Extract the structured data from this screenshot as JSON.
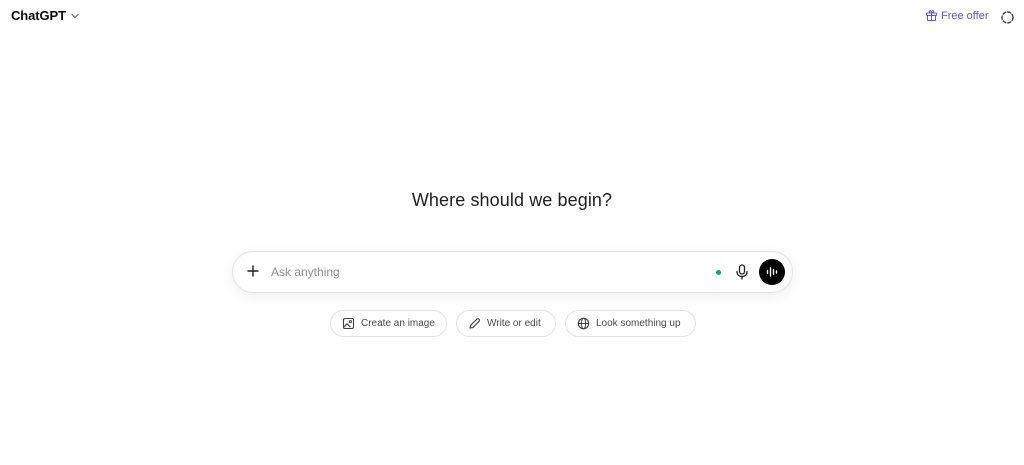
{
  "header": {
    "model_name": "ChatGPT",
    "free_offer_label": "Free offer"
  },
  "main": {
    "headline": "Where should we begin?"
  },
  "composer": {
    "placeholder": "Ask anything",
    "value": ""
  },
  "suggestions": [
    {
      "label": "Create an image",
      "icon": "image-icon"
    },
    {
      "label": "Write or edit",
      "icon": "pencil-icon"
    },
    {
      "label": "Look something up",
      "icon": "globe-icon"
    }
  ],
  "colors": {
    "accent": "#5b57d6",
    "status_dot": "#10a37f",
    "voice_button": "#000000"
  }
}
